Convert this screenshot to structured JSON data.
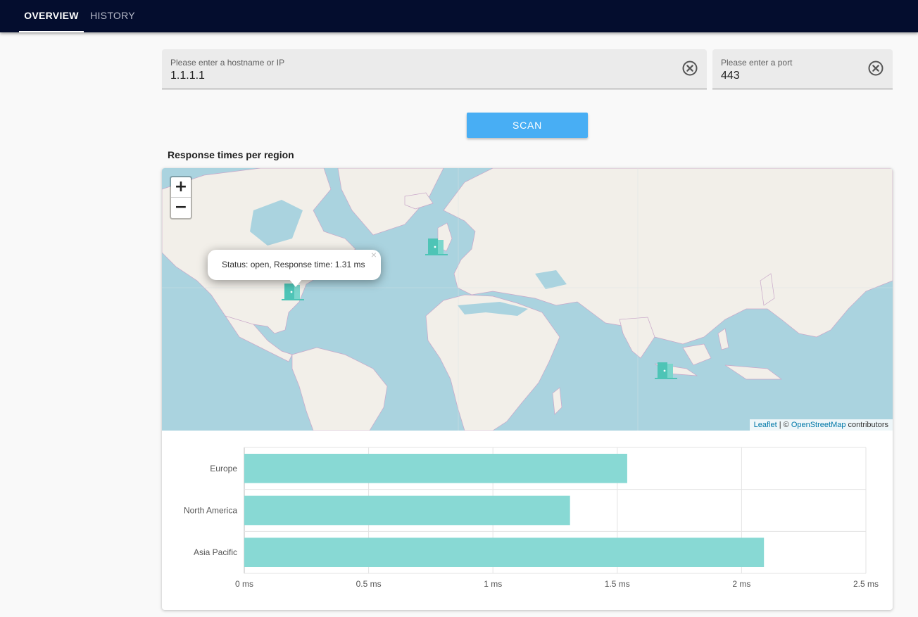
{
  "tabs": [
    {
      "label": "OVERVIEW",
      "active": true
    },
    {
      "label": "HISTORY",
      "active": false
    }
  ],
  "host_field": {
    "label": "Please enter a hostname or IP",
    "value": "1.1.1.1"
  },
  "port_field": {
    "label": "Please enter a port",
    "value": "443"
  },
  "scan_button": {
    "label": "SCAN"
  },
  "section_title": "Response times per region",
  "map": {
    "zoom_in": "+",
    "zoom_out": "−",
    "popup_text": "Status: open, Response time: 1.31 ms",
    "popup_close": "×",
    "attribution": {
      "leaflet": "Leaflet",
      "sep": " | © ",
      "osm": "OpenStreetMap",
      "suffix": " contributors"
    },
    "marker_icon": "door-icon",
    "marker_color": "#4ec4b6"
  },
  "chart_data": {
    "type": "bar",
    "orientation": "horizontal",
    "categories": [
      "Europe",
      "North America",
      "Asia Pacific"
    ],
    "values": [
      1.54,
      1.31,
      2.09
    ],
    "xlim": [
      0,
      2.5
    ],
    "xticks": [
      "0 ms",
      "0.5 ms",
      "1 ms",
      "1.5 ms",
      "2 ms",
      "2.5 ms"
    ],
    "grid": true,
    "bar_color": "#88d9d4"
  },
  "colors": {
    "appbar": "#040d2e",
    "accent": "#48aef4",
    "water": "#aad3df",
    "land": "#f2efe9"
  }
}
